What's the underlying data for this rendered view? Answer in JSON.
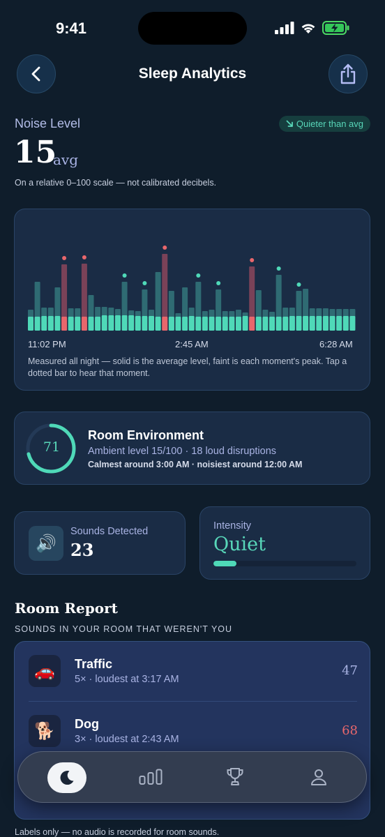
{
  "status": {
    "time": "9:41"
  },
  "header": {
    "title": "Sleep Analytics",
    "back_icon": "chevron-left-icon",
    "share_icon": "share-icon"
  },
  "noise": {
    "label": "Noise Level",
    "value": "15",
    "unit": "avg",
    "badge": "Quieter than avg",
    "note": "On a relative 0–100 scale — not calibrated decibels."
  },
  "chart_data": {
    "type": "bar",
    "x_labels": [
      "11:02 PM",
      "2:45 AM",
      "6:28 AM"
    ],
    "series": [
      {
        "name": "average",
        "values": [
          20,
          20,
          21,
          21,
          21,
          20,
          20,
          20,
          20,
          20,
          20,
          22,
          22,
          22,
          22,
          22,
          21,
          21,
          21,
          20,
          20,
          20,
          20,
          20,
          21,
          20,
          20,
          20,
          20,
          20,
          20,
          20,
          21,
          20,
          20,
          20,
          20,
          20,
          20,
          21,
          21,
          21,
          21,
          21,
          21,
          21,
          21,
          21,
          21
        ]
      },
      {
        "name": "peak",
        "values": [
          30,
          70,
          33,
          33,
          62,
          95,
          32,
          32,
          96,
          51,
          34,
          34,
          33,
          31,
          70,
          29,
          28,
          59,
          30,
          84,
          110,
          57,
          25,
          62,
          33,
          70,
          28,
          30,
          59,
          28,
          28,
          30,
          26,
          92,
          58,
          30,
          27,
          80,
          33,
          33,
          57,
          60,
          32,
          32,
          32,
          31,
          31,
          31,
          31
        ]
      }
    ],
    "disruptions": [
      {
        "index": 5,
        "loud": true
      },
      {
        "index": 8,
        "loud": true
      },
      {
        "index": 14,
        "loud": false
      },
      {
        "index": 17,
        "loud": false
      },
      {
        "index": 20,
        "loud": true
      },
      {
        "index": 25,
        "loud": false
      },
      {
        "index": 28,
        "loud": false
      },
      {
        "index": 33,
        "loud": true
      },
      {
        "index": 37,
        "loud": false
      },
      {
        "index": 40,
        "loud": false
      }
    ],
    "colors": {
      "average": "#4fd9b8",
      "peak": "#2f6b73",
      "loud": "#e8676c",
      "loud_peak": "#7a4258",
      "dot": "#4fd9b8"
    },
    "note": "Measured all night — solid is the average level, faint is each moment's peak. Tap a dotted bar to hear that moment."
  },
  "environment": {
    "score": "71",
    "score_value": 71,
    "title": "Room Environment",
    "subtitle": "Ambient level 15/100 · 18 loud disruptions",
    "note": "Calmest around 3:00 AM · noisiest around 12:00 AM"
  },
  "sounds": {
    "label": "Sounds Detected",
    "value": "23",
    "icon": "speaker-icon"
  },
  "intensity": {
    "label": "Intensity",
    "value": "Quiet",
    "level": 0.16
  },
  "report": {
    "title": "Room Report",
    "subtitle": "SOUNDS IN YOUR ROOM THAT WEREN'T YOU",
    "items": [
      {
        "icon": "🚗",
        "name": "Traffic",
        "detail": "5× · loudest at 3:17 AM",
        "score": "47",
        "score_color": "#a9b3e3"
      },
      {
        "icon": "🐕",
        "name": "Dog",
        "detail": "3× · loudest at 2:43 AM",
        "score": "68",
        "score_color": "#e8676c"
      }
    ],
    "footer": "Labels only — no audio is recorded for room sounds."
  },
  "tabs": [
    {
      "name": "sleep",
      "icon": "moon-icon",
      "active": true
    },
    {
      "name": "analytics",
      "icon": "bar-chart-icon",
      "active": false
    },
    {
      "name": "achievements",
      "icon": "trophy-icon",
      "active": false
    },
    {
      "name": "profile",
      "icon": "person-icon",
      "active": false
    }
  ]
}
